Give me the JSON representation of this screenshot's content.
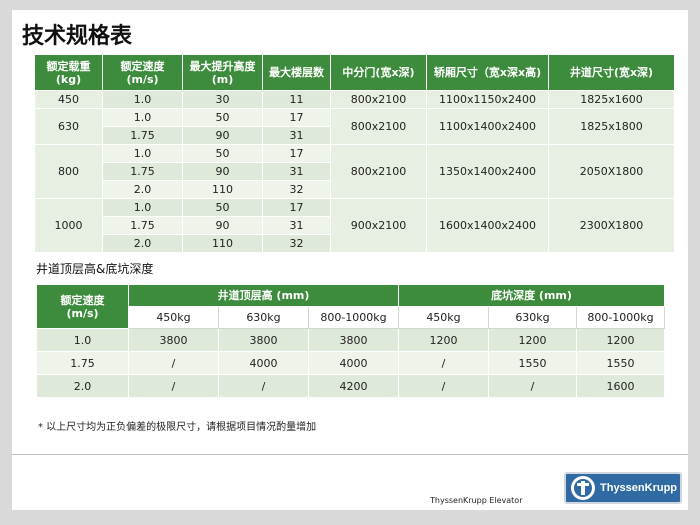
{
  "title": "技术规格表",
  "spec_table": {
    "headers": [
      "额定载重\n(kg)",
      "额定速度\n(m/s)",
      "最大提升高度\n(m)",
      "最大楼层数",
      "中分门(宽x深)",
      "轿厢尺寸（宽x深x高)",
      "井道尺寸(宽x深)"
    ],
    "groups": [
      {
        "load": "450",
        "door": "800x2100",
        "car": "1100x1150x2400",
        "shaft": "1825x1600",
        "rows": [
          {
            "speed": "1.0",
            "height": "30",
            "floors": "11"
          }
        ]
      },
      {
        "load": "630",
        "door": "800x2100",
        "car": "1100x1400x2400",
        "shaft": "1825x1800",
        "rows": [
          {
            "speed": "1.0",
            "height": "50",
            "floors": "17"
          },
          {
            "speed": "1.75",
            "height": "90",
            "floors": "31"
          }
        ]
      },
      {
        "load": "800",
        "door": "800x2100",
        "car": "1350x1400x2400",
        "shaft": "2050X1800",
        "rows": [
          {
            "speed": "1.0",
            "height": "50",
            "floors": "17"
          },
          {
            "speed": "1.75",
            "height": "90",
            "floors": "31"
          },
          {
            "speed": "2.0",
            "height": "110",
            "floors": "32"
          }
        ]
      },
      {
        "load": "1000",
        "door": "900x2100",
        "car": "1600x1400x2400",
        "shaft": "2300X1800",
        "rows": [
          {
            "speed": "1.0",
            "height": "50",
            "floors": "17"
          },
          {
            "speed": "1.75",
            "height": "90",
            "floors": "31"
          },
          {
            "speed": "2.0",
            "height": "110",
            "floors": "32"
          }
        ]
      }
    ]
  },
  "subtitle": "井道顶层高&底坑深度",
  "pit_table": {
    "speed_header": "额定速度\n(m/s)",
    "overhead_header": "井道顶层高 (mm)",
    "pit_header": "底坑深度 (mm)",
    "loads": [
      "450kg",
      "630kg",
      "800-1000kg",
      "450kg",
      "630kg",
      "800-1000kg"
    ],
    "rows": [
      {
        "speed": "1.0",
        "values": [
          "3800",
          "3800",
          "3800",
          "1200",
          "1200",
          "1200"
        ]
      },
      {
        "speed": "1.75",
        "values": [
          "/",
          "4000",
          "4000",
          "/",
          "1550",
          "1550"
        ]
      },
      {
        "speed": "2.0",
        "values": [
          "/",
          "/",
          "4200",
          "/",
          "/",
          "1600"
        ]
      }
    ]
  },
  "note": "* 以上尺寸均为正负偏差的极限尺寸，请根据项目情况酌量增加",
  "footer": {
    "company": "ThyssenKrupp Elevator",
    "logo_text": "ThyssenKrupp"
  },
  "colors": {
    "header_green": "#3d8b3d",
    "row_light": "#eef4ea",
    "row_dark": "#dfe9d9",
    "logo_blue": "#2f6aa3"
  }
}
